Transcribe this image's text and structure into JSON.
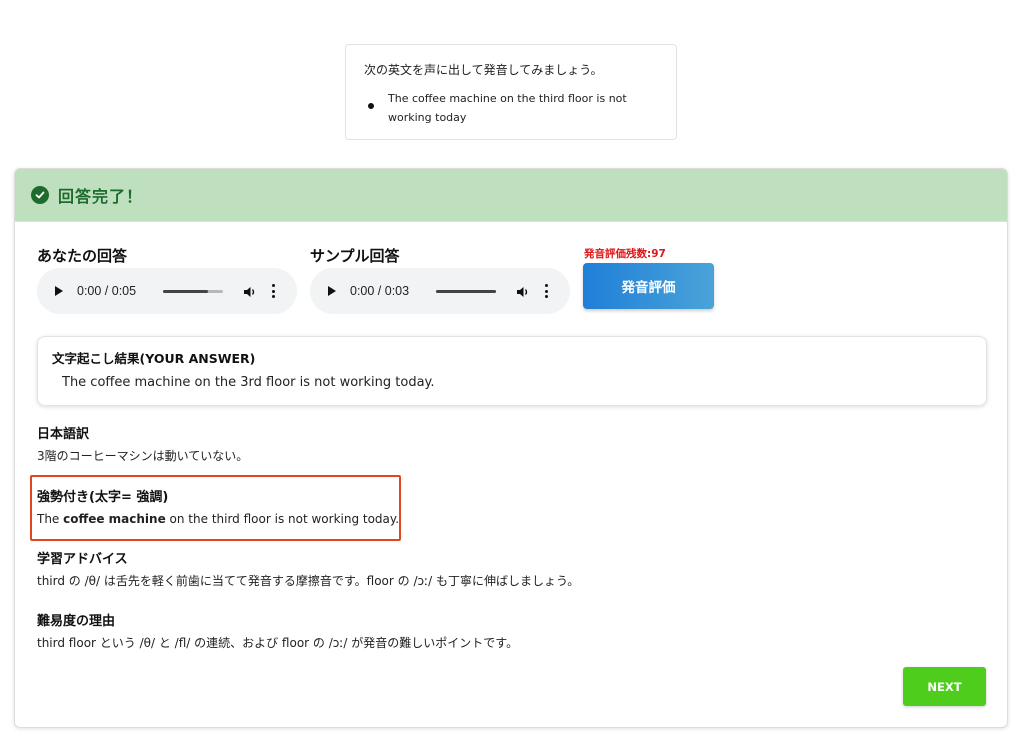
{
  "prompt": {
    "instruction": "次の英文を声に出して発音してみましょう。",
    "sentence": "The coffee machine on the third floor is not working today"
  },
  "result": {
    "title": "回答完了！",
    "your_answer_label": "あなたの回答",
    "your_answer_time": "0:00 / 0:05",
    "your_answer_progress": 0.75,
    "sample_answer_label": "サンプル回答",
    "sample_answer_time": "0:00 / 0:03",
    "sample_answer_progress": 1.0,
    "remaining_label": "発音評価残数:97",
    "assess_button_label": "発音評価",
    "transcript_title": "文字起こし結果(YOUR ANSWER)",
    "transcript_text": "The coffee machine on the 3rd floor is not working today.",
    "japanese_title": "日本語訳",
    "japanese_text": "3階のコーヒーマシンは動いていない。",
    "emphasis_title": "強勢付き(太字= 強調)",
    "emphasis_before": "The ",
    "emphasis_bold": "coffee machine",
    "emphasis_after": " on the third floor is not working today.",
    "advice_title": "学習アドバイス",
    "advice_text": "third の /θ/ は舌先を軽く前歯に当てて発音する摩擦音です。floor の /ɔː/ も丁寧に伸ばしましょう。",
    "difficulty_title": "難易度の理由",
    "difficulty_text": "third floor という /θ/ と /fl/ の連続、および floor の /ɔː/ が発音の難しいポイントです。",
    "next_label": "NEXT"
  },
  "colors": {
    "header_bg": "#bfe0bf",
    "success_green": "#1f6b2e",
    "remaining_red": "#e01616",
    "assess_blue": "#1f7fd8",
    "emphasis_border": "#e2461f",
    "next_green": "#4fcd1c"
  },
  "icons": {
    "header": "check-circle-icon",
    "play": "play-icon",
    "volume": "volume-icon",
    "more": "more-vertical-icon"
  }
}
